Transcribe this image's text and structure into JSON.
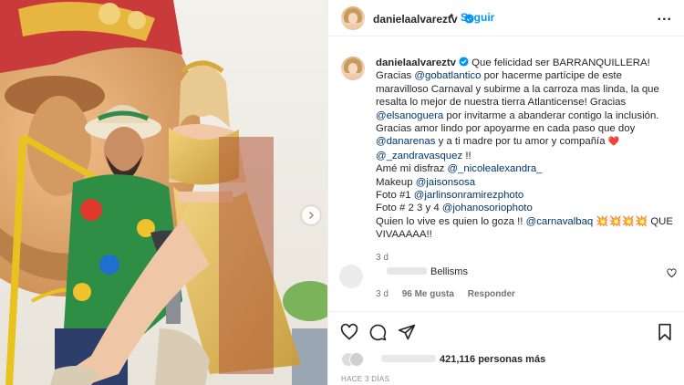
{
  "post": {
    "username": "danielaalvareztv",
    "verified": true,
    "follow_label": "Seguir",
    "separator": "•",
    "more_label": "..."
  },
  "caption": {
    "username": "danielaalvareztv",
    "segments": [
      {
        "t": "text",
        "v": " Que felicidad ser BARRANQUILLERA! Gracias "
      },
      {
        "t": "tag",
        "v": "@gobatlantico"
      },
      {
        "t": "text",
        "v": " por hacerme partícipe de este maravilloso Carnaval y subirme a la carroza mas linda, la que resalta lo mejor de nuestra tierra Atlanticense! Gracias "
      },
      {
        "t": "tag",
        "v": "@elsanoguera"
      },
      {
        "t": "text",
        "v": " por invitarme a abanderar contigo la inclusión. Gracias amor lindo por apoyarme en cada paso que doy "
      },
      {
        "t": "tag",
        "v": "@danarenas"
      },
      {
        "t": "text",
        "v": " y a ti madre por tu amor y compañía "
      },
      {
        "t": "emoji",
        "v": "❤️"
      },
      {
        "t": "text",
        "v": " "
      },
      {
        "t": "tag",
        "v": "@_zandravasquez"
      },
      {
        "t": "text",
        "v": " !!"
      }
    ],
    "lines": [
      {
        "pre": "Amé mi disfraz ",
        "tag": "@_nicolealexandra_",
        "post": ""
      },
      {
        "pre": "Makeup ",
        "tag": "@jaisonsosa",
        "post": ""
      },
      {
        "pre": "Foto #1 ",
        "tag": "@jarlinsonramirezphoto",
        "post": ""
      },
      {
        "pre": "Foto # 2 3 y 4 ",
        "tag": "@johanosoriophoto",
        "post": ""
      },
      {
        "pre": "Quien lo vive es quien lo goza !! ",
        "tag": "@carnavalbaq",
        "post": " 💥💥💥💥 QUE VIVAAAAA!!"
      }
    ],
    "age": "3 d"
  },
  "comment": {
    "text": "Bellisms",
    "age": "3 d",
    "likes": "96 Me gusta",
    "reply_label": "Responder"
  },
  "likes": {
    "count": "421,116",
    "suffix": " personas más"
  },
  "posted_ago": "HACE 3 DÍAS",
  "icons": [
    "heart-icon",
    "comment-icon",
    "share-icon",
    "bookmark-icon",
    "verified-badge-icon",
    "chevron-right-icon",
    "more-options-icon"
  ],
  "colors": {
    "link": "#00376b",
    "accent": "#0095f6",
    "verified": "#0095f6",
    "heart": "#ed1c24"
  }
}
